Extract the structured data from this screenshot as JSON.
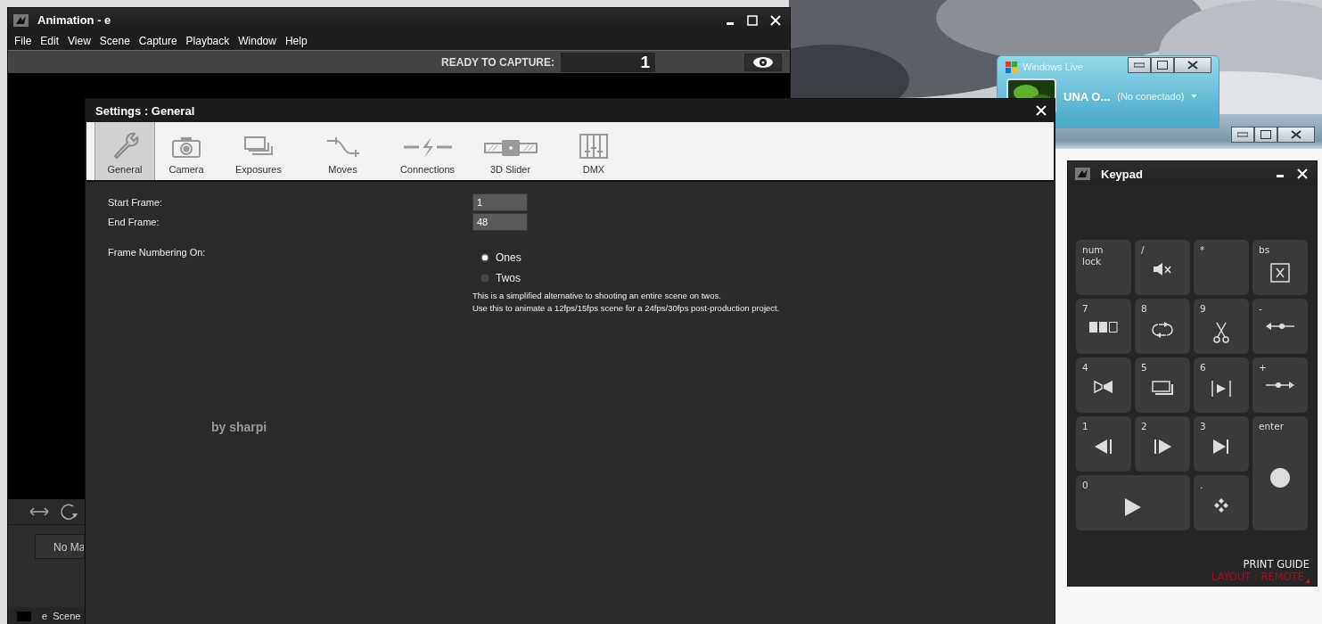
{
  "animation_window": {
    "title": "Animation - e",
    "menu": [
      "File",
      "Edit",
      "View",
      "Scene",
      "Capture",
      "Playback",
      "Window",
      "Help"
    ],
    "status_label": "READY TO CAPTURE:",
    "frame_counter": "1",
    "panel_button": "No Ma",
    "scene_tab": "e  Scene"
  },
  "windows_live": {
    "title": "Windows Live",
    "name": "UNA O...",
    "status": "(No conectado)"
  },
  "settings": {
    "title": "Settings : General",
    "tabs": [
      {
        "label": "General",
        "selected": true
      },
      {
        "label": "Camera",
        "selected": false
      },
      {
        "label": "Exposures",
        "selected": false
      },
      {
        "label": "Moves",
        "selected": false
      },
      {
        "label": "Connections",
        "selected": false
      },
      {
        "label": "3D Slider",
        "selected": false
      },
      {
        "label": "DMX",
        "selected": false
      }
    ],
    "fields": [
      {
        "label": "Start Frame:",
        "value": "1"
      },
      {
        "label": "End Frame:",
        "value": "48"
      }
    ],
    "frame_numbering": {
      "label": "Frame Numbering On:",
      "options": [
        {
          "label": "Ones",
          "selected": true
        },
        {
          "label": "Twos",
          "selected": false
        }
      ],
      "note": [
        "This is a simplified alternative to shooting an entire scene on twos.",
        "Use this to animate a 12fps/15fps scene for a 24fps/30fps post-production project."
      ]
    },
    "credit": "by sharpi"
  },
  "keypad": {
    "title": "Keypad",
    "keys": [
      {
        "label": "num lock",
        "kind": "normal"
      },
      {
        "label": "/",
        "kind": "normal"
      },
      {
        "label": "*",
        "kind": "normal"
      },
      {
        "label": "bs",
        "kind": "normal"
      },
      {
        "label": "7",
        "kind": "normal"
      },
      {
        "label": "8",
        "kind": "normal"
      },
      {
        "label": "9",
        "kind": "normal"
      },
      {
        "label": "-",
        "kind": "normal"
      },
      {
        "label": "4",
        "kind": "normal"
      },
      {
        "label": "5",
        "kind": "normal"
      },
      {
        "label": "6",
        "kind": "normal"
      },
      {
        "label": "+",
        "kind": "normal"
      },
      {
        "label": "1",
        "kind": "normal"
      },
      {
        "label": "2",
        "kind": "normal"
      },
      {
        "label": "3",
        "kind": "normal"
      },
      {
        "label": "enter",
        "kind": "tall"
      },
      {
        "label": "0",
        "kind": "wide"
      },
      {
        "label": ".",
        "kind": "normal"
      }
    ],
    "print_guide": "PRINT GUIDE",
    "layout": "LAYOUT : REMOTE"
  }
}
